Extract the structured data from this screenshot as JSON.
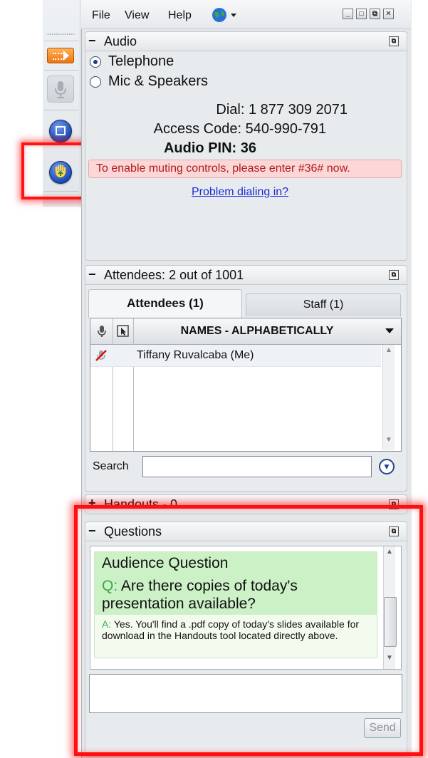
{
  "menu": {
    "file": "File",
    "view": "View",
    "help": "Help"
  },
  "audio": {
    "title": "Audio",
    "toggle": "−",
    "options": [
      "Telephone",
      "Mic & Speakers"
    ],
    "selected": "Telephone",
    "dial": "Dial: 1 877 309 2071",
    "access_code": "Access Code: 540-990-791",
    "pin": "Audio PIN: 36",
    "warning": "To enable muting controls, please enter #36# now.",
    "problem_link": "Problem dialing in?"
  },
  "attendees": {
    "title": "Attendees:  2 out of 1001",
    "toggle": "−",
    "tabs": [
      "Attendees (1)",
      "Staff (1)"
    ],
    "column_header": "NAMES - ALPHABETICALLY",
    "rows": [
      "Tiffany Ruvalcaba (Me)"
    ],
    "search_label": "Search",
    "search_value": ""
  },
  "handouts": {
    "title": "Handouts - 0",
    "toggle": "+"
  },
  "questions": {
    "title": "Questions",
    "toggle": "−",
    "heading": "Audience Question",
    "q_prefix": "Q:",
    "question": "Are there copies of today's presentation available?",
    "a_prefix": "A:",
    "answer": "Yes.  You'll find a .pdf copy of today's slides available for download in the Handouts tool located directly above.",
    "send_label": "Send"
  },
  "colors": {
    "highlight": "#ff1010",
    "warning_bg": "#fbd7d7",
    "question_bg": "#cdf1c7",
    "link": "#1a2ad6"
  }
}
